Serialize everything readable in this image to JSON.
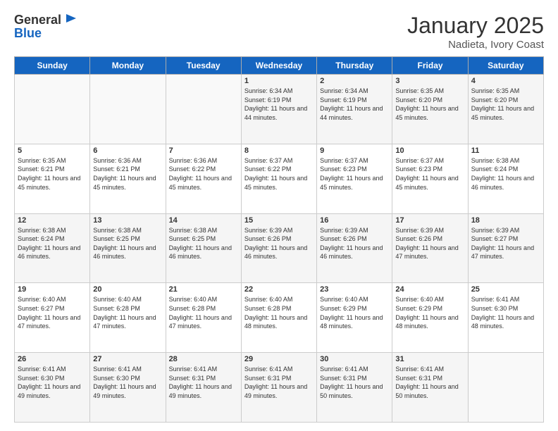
{
  "header": {
    "logo": {
      "general": "General",
      "blue": "Blue"
    },
    "title": "January 2025",
    "location": "Nadieta, Ivory Coast"
  },
  "days_of_week": [
    "Sunday",
    "Monday",
    "Tuesday",
    "Wednesday",
    "Thursday",
    "Friday",
    "Saturday"
  ],
  "weeks": [
    [
      {
        "day": "",
        "info": ""
      },
      {
        "day": "",
        "info": ""
      },
      {
        "day": "",
        "info": ""
      },
      {
        "day": "1",
        "info": "Sunrise: 6:34 AM\nSunset: 6:19 PM\nDaylight: 11 hours and 44 minutes."
      },
      {
        "day": "2",
        "info": "Sunrise: 6:34 AM\nSunset: 6:19 PM\nDaylight: 11 hours and 44 minutes."
      },
      {
        "day": "3",
        "info": "Sunrise: 6:35 AM\nSunset: 6:20 PM\nDaylight: 11 hours and 45 minutes."
      },
      {
        "day": "4",
        "info": "Sunrise: 6:35 AM\nSunset: 6:20 PM\nDaylight: 11 hours and 45 minutes."
      }
    ],
    [
      {
        "day": "5",
        "info": "Sunrise: 6:35 AM\nSunset: 6:21 PM\nDaylight: 11 hours and 45 minutes."
      },
      {
        "day": "6",
        "info": "Sunrise: 6:36 AM\nSunset: 6:21 PM\nDaylight: 11 hours and 45 minutes."
      },
      {
        "day": "7",
        "info": "Sunrise: 6:36 AM\nSunset: 6:22 PM\nDaylight: 11 hours and 45 minutes."
      },
      {
        "day": "8",
        "info": "Sunrise: 6:37 AM\nSunset: 6:22 PM\nDaylight: 11 hours and 45 minutes."
      },
      {
        "day": "9",
        "info": "Sunrise: 6:37 AM\nSunset: 6:23 PM\nDaylight: 11 hours and 45 minutes."
      },
      {
        "day": "10",
        "info": "Sunrise: 6:37 AM\nSunset: 6:23 PM\nDaylight: 11 hours and 45 minutes."
      },
      {
        "day": "11",
        "info": "Sunrise: 6:38 AM\nSunset: 6:24 PM\nDaylight: 11 hours and 46 minutes."
      }
    ],
    [
      {
        "day": "12",
        "info": "Sunrise: 6:38 AM\nSunset: 6:24 PM\nDaylight: 11 hours and 46 minutes."
      },
      {
        "day": "13",
        "info": "Sunrise: 6:38 AM\nSunset: 6:25 PM\nDaylight: 11 hours and 46 minutes."
      },
      {
        "day": "14",
        "info": "Sunrise: 6:38 AM\nSunset: 6:25 PM\nDaylight: 11 hours and 46 minutes."
      },
      {
        "day": "15",
        "info": "Sunrise: 6:39 AM\nSunset: 6:26 PM\nDaylight: 11 hours and 46 minutes."
      },
      {
        "day": "16",
        "info": "Sunrise: 6:39 AM\nSunset: 6:26 PM\nDaylight: 11 hours and 46 minutes."
      },
      {
        "day": "17",
        "info": "Sunrise: 6:39 AM\nSunset: 6:26 PM\nDaylight: 11 hours and 47 minutes."
      },
      {
        "day": "18",
        "info": "Sunrise: 6:39 AM\nSunset: 6:27 PM\nDaylight: 11 hours and 47 minutes."
      }
    ],
    [
      {
        "day": "19",
        "info": "Sunrise: 6:40 AM\nSunset: 6:27 PM\nDaylight: 11 hours and 47 minutes."
      },
      {
        "day": "20",
        "info": "Sunrise: 6:40 AM\nSunset: 6:28 PM\nDaylight: 11 hours and 47 minutes."
      },
      {
        "day": "21",
        "info": "Sunrise: 6:40 AM\nSunset: 6:28 PM\nDaylight: 11 hours and 47 minutes."
      },
      {
        "day": "22",
        "info": "Sunrise: 6:40 AM\nSunset: 6:28 PM\nDaylight: 11 hours and 48 minutes."
      },
      {
        "day": "23",
        "info": "Sunrise: 6:40 AM\nSunset: 6:29 PM\nDaylight: 11 hours and 48 minutes."
      },
      {
        "day": "24",
        "info": "Sunrise: 6:40 AM\nSunset: 6:29 PM\nDaylight: 11 hours and 48 minutes."
      },
      {
        "day": "25",
        "info": "Sunrise: 6:41 AM\nSunset: 6:30 PM\nDaylight: 11 hours and 48 minutes."
      }
    ],
    [
      {
        "day": "26",
        "info": "Sunrise: 6:41 AM\nSunset: 6:30 PM\nDaylight: 11 hours and 49 minutes."
      },
      {
        "day": "27",
        "info": "Sunrise: 6:41 AM\nSunset: 6:30 PM\nDaylight: 11 hours and 49 minutes."
      },
      {
        "day": "28",
        "info": "Sunrise: 6:41 AM\nSunset: 6:31 PM\nDaylight: 11 hours and 49 minutes."
      },
      {
        "day": "29",
        "info": "Sunrise: 6:41 AM\nSunset: 6:31 PM\nDaylight: 11 hours and 49 minutes."
      },
      {
        "day": "30",
        "info": "Sunrise: 6:41 AM\nSunset: 6:31 PM\nDaylight: 11 hours and 50 minutes."
      },
      {
        "day": "31",
        "info": "Sunrise: 6:41 AM\nSunset: 6:31 PM\nDaylight: 11 hours and 50 minutes."
      },
      {
        "day": "",
        "info": ""
      }
    ]
  ]
}
